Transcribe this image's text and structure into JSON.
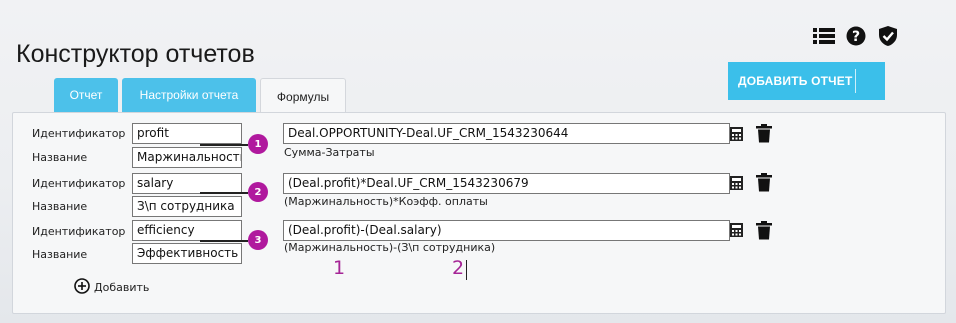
{
  "page": {
    "title": "Конструктор отчетов"
  },
  "top_icons": [
    "list-icon",
    "help-icon",
    "shield-check-icon"
  ],
  "actions": {
    "add_report": "ДОБАВИТЬ ОТЧЕТ"
  },
  "tabs": [
    {
      "label": "Отчет",
      "state": "inactive"
    },
    {
      "label": "Настройки отчета",
      "state": "inactive"
    },
    {
      "label": "Формулы",
      "state": "active"
    }
  ],
  "labels": {
    "identifier": "Идентификатор",
    "name": "Название"
  },
  "formulas": [
    {
      "badge": "1",
      "identifier": "profit",
      "name": "Маржинальность",
      "formula": "Deal.OPPORTUNITY-Deal.UF_CRM_1543230644",
      "hint": "Сумма-Затраты"
    },
    {
      "badge": "2",
      "identifier": "salary",
      "name": "З\\п сотрудника",
      "formula": "(Deal.profit)*Deal.UF_CRM_1543230679",
      "hint": "(Маржинальность)*Коэфф. оплаты"
    },
    {
      "badge": "3",
      "identifier": "efficiency",
      "name": "Эффективность",
      "formula": "(Deal.profit)-(Deal.salary)",
      "hint": "(Маржинальность)-(З\\п сотрудника)"
    }
  ],
  "add_formula": "Добавить",
  "annotations": [
    "1",
    "2"
  ],
  "colors": {
    "accent": "#3bbfea",
    "badge": "#b0199e",
    "annotation": "#a52596"
  }
}
